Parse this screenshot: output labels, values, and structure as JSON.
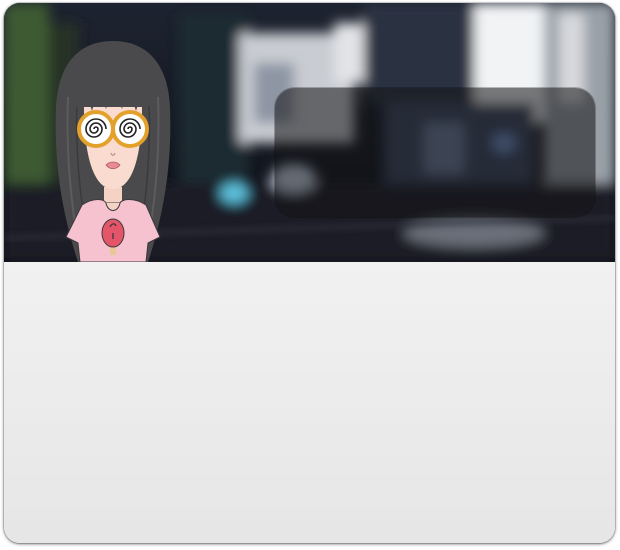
{
  "card": {
    "header_background": "blurred-night-street-photo",
    "overlay_panel": "translucent-dark-panel",
    "avatar": "cartoon-girl-avatar"
  },
  "colors": {
    "body_background": "#ebebeb",
    "panel_fill": "#141416",
    "avatar_hair": "#4a4a4c",
    "avatar_glasses": "#e3a12b",
    "avatar_shirt": "#f6c2cf",
    "avatar_popsicle": "#e5556a"
  }
}
